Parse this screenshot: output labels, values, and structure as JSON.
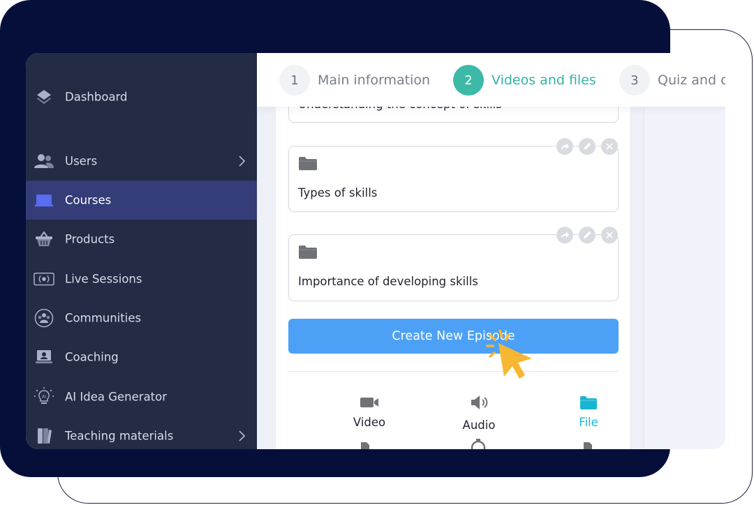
{
  "sidebar": {
    "items": [
      {
        "label": "Dashboard",
        "icon": "layers-icon",
        "has_chevron": false,
        "active": false
      },
      {
        "label": "Users",
        "icon": "users-icon",
        "has_chevron": true,
        "active": false
      },
      {
        "label": "Courses",
        "icon": "laptop-icon",
        "has_chevron": false,
        "active": true
      },
      {
        "label": "Products",
        "icon": "basket-icon",
        "has_chevron": false,
        "active": false
      },
      {
        "label": "Live Sessions",
        "icon": "broadcast-icon",
        "has_chevron": false,
        "active": false
      },
      {
        "label": "Communities",
        "icon": "community-icon",
        "has_chevron": false,
        "active": false
      },
      {
        "label": "Coaching",
        "icon": "coaching-icon",
        "has_chevron": false,
        "active": false
      },
      {
        "label": "AI Idea Generator",
        "icon": "ai-bulb-icon",
        "has_chevron": false,
        "active": false
      },
      {
        "label": "Teaching materials",
        "icon": "book-icon",
        "has_chevron": true,
        "active": false
      }
    ]
  },
  "stepper": {
    "steps": [
      {
        "number": "1",
        "label": "Main information",
        "current": false
      },
      {
        "number": "2",
        "label": "Videos and files",
        "current": true
      },
      {
        "number": "3",
        "label": "Quiz and c",
        "current": false
      }
    ]
  },
  "episodes": [
    {
      "title": "Understanding the concept of skills"
    },
    {
      "title": "Types of skills"
    },
    {
      "title": "Importance of developing skills"
    }
  ],
  "create_button": {
    "label": "Create New Episode"
  },
  "content_types": [
    {
      "label": "Video",
      "icon": "video-camera-icon",
      "selected": false
    },
    {
      "label": "Audio",
      "icon": "speaker-icon",
      "selected": false
    },
    {
      "label": "File",
      "icon": "folder-icon",
      "selected": true
    }
  ],
  "colors": {
    "sidebar_bg": "#232b45",
    "sidebar_active": "#343d78",
    "accent_teal": "#3db9a8",
    "button_blue": "#4ca1f6",
    "selected_cyan": "#19b6d4",
    "cursor_orange": "#f7b733",
    "frame_navy": "#050f3a"
  }
}
